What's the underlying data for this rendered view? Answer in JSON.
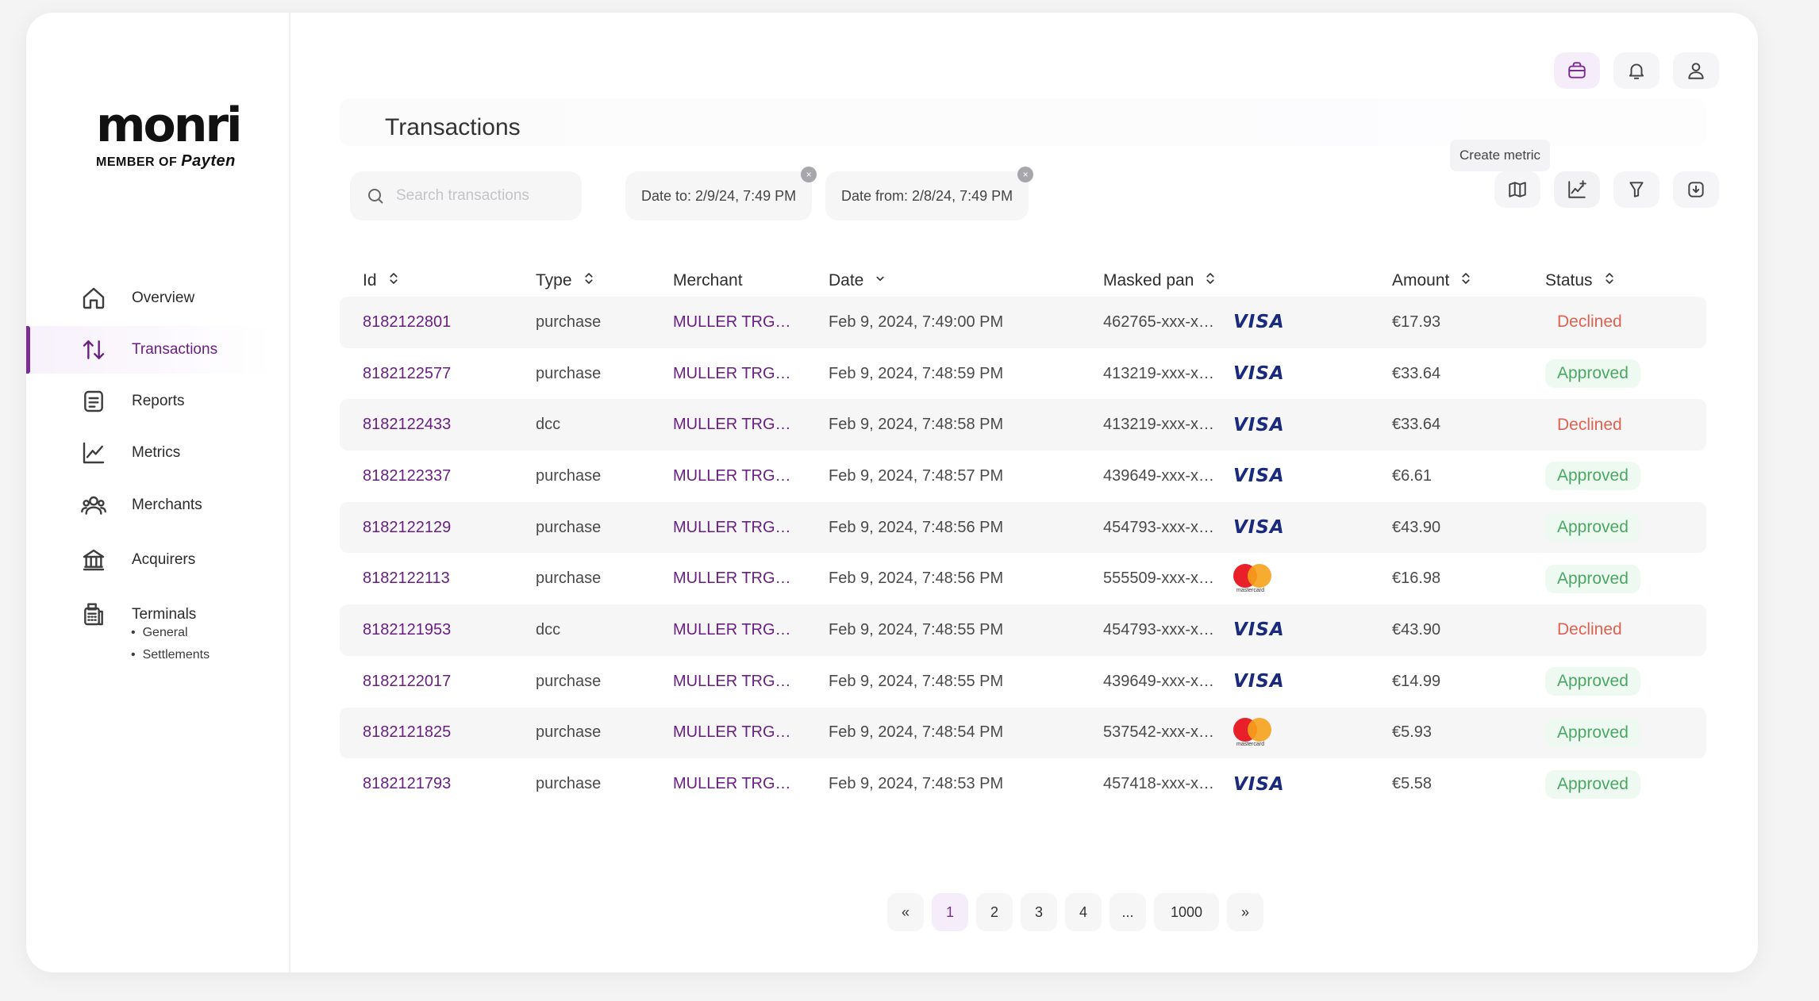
{
  "brand": {
    "logo_word": "monri",
    "member_of": "MEMBER OF",
    "payten": "Payten"
  },
  "sidebar": {
    "items": [
      {
        "label": "Overview",
        "icon": "home-icon"
      },
      {
        "label": "Transactions",
        "icon": "arrows-up-down-icon",
        "active": true
      },
      {
        "label": "Reports",
        "icon": "document-icon"
      },
      {
        "label": "Metrics",
        "icon": "line-chart-icon"
      },
      {
        "label": "Merchants",
        "icon": "users-icon"
      },
      {
        "label": "Acquirers",
        "icon": "bank-icon"
      },
      {
        "label": "Terminals",
        "icon": "terminal-icon"
      }
    ],
    "terminal_subitems": [
      "General",
      "Settlements"
    ]
  },
  "header": {
    "title": "Transactions"
  },
  "top_actions": [
    "briefcase-icon",
    "bell-icon",
    "user-icon"
  ],
  "search": {
    "placeholder": "Search transactions",
    "value": ""
  },
  "filters": [
    {
      "label": "Date to: 2/9/24, 7:49 PM"
    },
    {
      "label": "Date from: 2/8/24, 7:49 PM"
    }
  ],
  "tooltip": "Create metric",
  "tools": [
    "map-icon",
    "create-metric-icon",
    "filter-icon",
    "download-icon"
  ],
  "table": {
    "columns": [
      "Id",
      "Type",
      "Merchant",
      "Date",
      "Masked pan",
      "Amount",
      "Status"
    ],
    "rows": [
      {
        "id": "8182122801",
        "type": "purchase",
        "merchant": "MULLER TRG…",
        "date": "Feb 9, 2024, 7:49:00 PM",
        "pan": "462765-xxx-x…",
        "card": "visa",
        "amount": "€17.93",
        "status": "Declined"
      },
      {
        "id": "8182122577",
        "type": "purchase",
        "merchant": "MULLER TRG…",
        "date": "Feb 9, 2024, 7:48:59 PM",
        "pan": "413219-xxx-x…",
        "card": "visa",
        "amount": "€33.64",
        "status": "Approved"
      },
      {
        "id": "8182122433",
        "type": "dcc",
        "merchant": "MULLER TRG…",
        "date": "Feb 9, 2024, 7:48:58 PM",
        "pan": "413219-xxx-x…",
        "card": "visa",
        "amount": "€33.64",
        "status": "Declined"
      },
      {
        "id": "8182122337",
        "type": "purchase",
        "merchant": "MULLER TRG…",
        "date": "Feb 9, 2024, 7:48:57 PM",
        "pan": "439649-xxx-x…",
        "card": "visa",
        "amount": "€6.61",
        "status": "Approved"
      },
      {
        "id": "8182122129",
        "type": "purchase",
        "merchant": "MULLER TRG…",
        "date": "Feb 9, 2024, 7:48:56 PM",
        "pan": "454793-xxx-x…",
        "card": "visa",
        "amount": "€43.90",
        "status": "Approved"
      },
      {
        "id": "8182122113",
        "type": "purchase",
        "merchant": "MULLER TRG…",
        "date": "Feb 9, 2024, 7:48:56 PM",
        "pan": "555509-xxx-x…",
        "card": "mastercard",
        "amount": "€16.98",
        "status": "Approved"
      },
      {
        "id": "8182121953",
        "type": "dcc",
        "merchant": "MULLER TRG…",
        "date": "Feb 9, 2024, 7:48:55 PM",
        "pan": "454793-xxx-x…",
        "card": "visa",
        "amount": "€43.90",
        "status": "Declined"
      },
      {
        "id": "8182122017",
        "type": "purchase",
        "merchant": "MULLER TRG…",
        "date": "Feb 9, 2024, 7:48:55 PM",
        "pan": "439649-xxx-x…",
        "card": "visa",
        "amount": "€14.99",
        "status": "Approved"
      },
      {
        "id": "8182121825",
        "type": "purchase",
        "merchant": "MULLER TRG…",
        "date": "Feb 9, 2024, 7:48:54 PM",
        "pan": "537542-xxx-x…",
        "card": "mastercard",
        "amount": "€5.93",
        "status": "Approved"
      },
      {
        "id": "8182121793",
        "type": "purchase",
        "merchant": "MULLER TRG…",
        "date": "Feb 9, 2024, 7:48:53 PM",
        "pan": "457418-xxx-x…",
        "card": "visa",
        "amount": "€5.58",
        "status": "Approved"
      }
    ]
  },
  "card_labels": {
    "visa": "VISA",
    "mastercard": "mastercard"
  },
  "pagination": {
    "prev": "«",
    "pages": [
      "1",
      "2",
      "3",
      "4",
      "...",
      "1000"
    ],
    "current": "1",
    "next": "»"
  },
  "colors": {
    "accent": "#7b2d91",
    "approved": "#4aa863",
    "declined": "#e0614f",
    "visa": "#1a2a7c"
  }
}
